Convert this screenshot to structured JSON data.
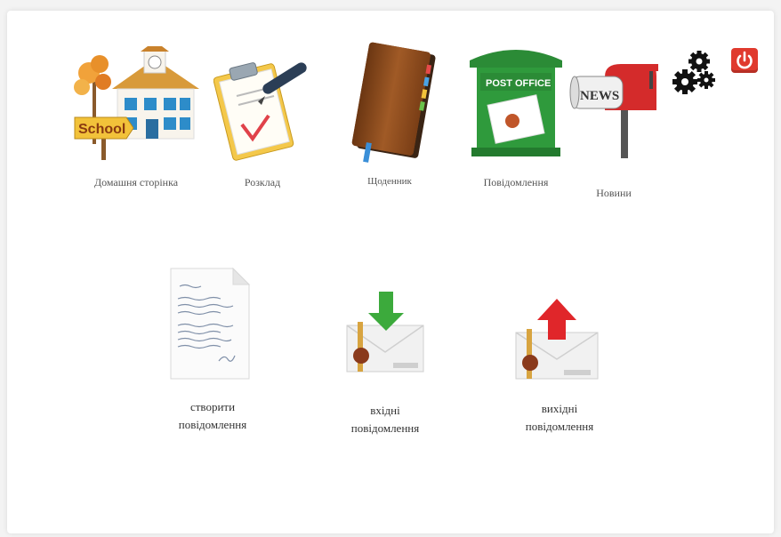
{
  "nav": {
    "items": [
      {
        "label": "Домашня сторінка",
        "icon": "school-icon"
      },
      {
        "label": "Розклад",
        "icon": "clipboard-pen-icon"
      },
      {
        "label": "Щоденник",
        "icon": "notebook-icon"
      },
      {
        "label": "Повідомлення",
        "icon": "post-office-icon"
      },
      {
        "label": "Новини",
        "icon": "news-mailbox-icon"
      }
    ],
    "settings_icon": "gears-icon",
    "logout_icon": "power-icon"
  },
  "icons_text": {
    "school_sign": "School",
    "post_office": "POST OFFICE",
    "news": "NEWS"
  },
  "actions": {
    "create": {
      "line1": "створити",
      "line2": "повідомлення",
      "icon": "handwritten-letter-icon"
    },
    "inbox": {
      "line1": "вхідні",
      "line2": "повідомлення",
      "icon": "inbox-envelope-icon"
    },
    "outbox": {
      "line1": "вихідні",
      "line2": "повідомлення",
      "icon": "outbox-envelope-icon"
    }
  },
  "colors": {
    "logout": "#e03a2e",
    "postbox": "#2f9a3c",
    "notebook": "#8a4a1e",
    "inbox_arrow": "#3caa3c",
    "outbox_arrow": "#e0262a"
  }
}
